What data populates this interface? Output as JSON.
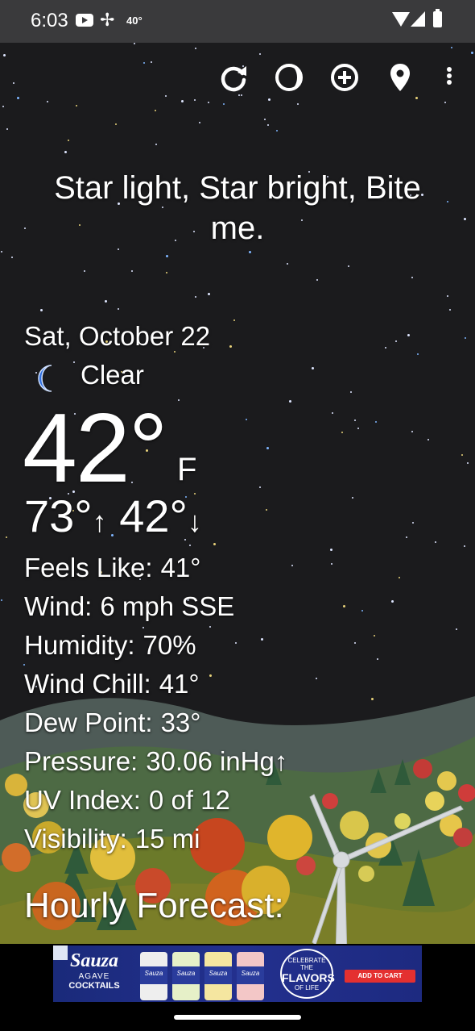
{
  "status_bar": {
    "time": "6:03",
    "temp": "40°",
    "icons": [
      "youtube-icon",
      "fan-icon",
      "wifi-icon",
      "signal-icon",
      "battery-icon"
    ]
  },
  "toolbar": {
    "icons": [
      "refresh-icon",
      "theme-icon",
      "add-location-icon",
      "location-pin-icon",
      "more-options-icon"
    ]
  },
  "quote": "Star light, Star bright, Bite me.",
  "weather": {
    "date": "Sat, October 22",
    "condition_icon": "moon-icon",
    "condition": "Clear",
    "temp": "42°",
    "unit": "F",
    "high": "73°",
    "high_arrow": "↑",
    "low": "42°",
    "low_arrow": "↓",
    "details": [
      {
        "label": "Feels Like:",
        "value": "41°"
      },
      {
        "label": "Wind:",
        "value": "6 mph SSE"
      },
      {
        "label": "Humidity:",
        "value": "70%"
      },
      {
        "label": "Wind Chill:",
        "value": "41°"
      },
      {
        "label": "Dew Point:",
        "value": "33°"
      },
      {
        "label": "Pressure:",
        "value": "30.06 inHg↑"
      },
      {
        "label": "UV Index:",
        "value": "0 of 12"
      },
      {
        "label": "Visibility:",
        "value": "15 mi"
      }
    ],
    "hourly_title": "Hourly Forecast:"
  },
  "ad": {
    "brand": "Sauza",
    "brand_sub": "AGAVE",
    "brand_sub2": "COCKTAILS",
    "can_label": "Sauza",
    "badge_top": "CELEBRATE THE",
    "badge_main": "FLAVORS",
    "badge_bottom": "OF LIFE",
    "cta": "ADD TO CART"
  },
  "colors": {
    "sky": "#1b1b1d",
    "status_bar": "#3a3a3c",
    "text": "#ffffff",
    "moon": "#2f6fe0",
    "ad_bg": "#23308e",
    "ad_cta": "#e43030"
  }
}
